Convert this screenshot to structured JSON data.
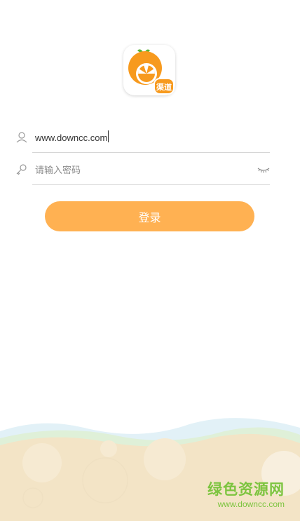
{
  "app": {
    "logo_badge": "渠道"
  },
  "login_form": {
    "username_value": "www.downcc.com",
    "password_placeholder": "请输入密码",
    "login_button": "登录"
  },
  "watermark": {
    "brand_cn": "绿色资源网",
    "url": "www.downcc.com"
  },
  "colors": {
    "accent": "#ffb152",
    "logo_orange": "#f79a1e",
    "watermark_green": "#7cc43f"
  },
  "icons": [
    "app-logo-icon",
    "user-icon",
    "key-icon",
    "eye-closed-icon"
  ]
}
